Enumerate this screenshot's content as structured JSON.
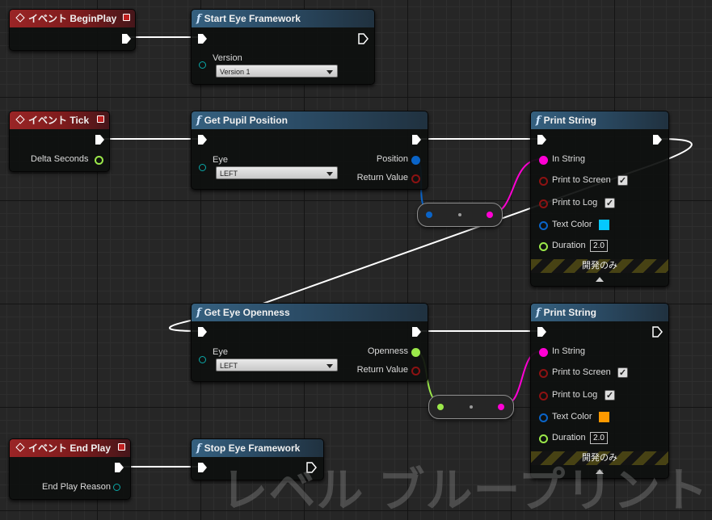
{
  "colors": {
    "exec": "#ffffff",
    "vector": "#0a64c8",
    "bool": "#8c1212",
    "string": "#ff00d4",
    "color_struct": "#0a64c8",
    "float": "#9be84a",
    "text_color_1": "#05c8ff",
    "text_color_2": "#ff9a00"
  },
  "watermark": "レベル ブループリント",
  "nodes": {
    "begin_play": {
      "title": "イベント BeginPlay"
    },
    "start_eye": {
      "title": "Start Eye Framework",
      "version_label": "Version",
      "version_value": "Version 1"
    },
    "tick": {
      "title": "イベント Tick",
      "delta_label": "Delta Seconds"
    },
    "get_pupil": {
      "title": "Get Pupil Position",
      "eye_label": "Eye",
      "eye_value": "LEFT",
      "out_position": "Position",
      "out_return": "Return Value"
    },
    "print1": {
      "title": "Print String",
      "in_string": "In String",
      "print_screen": "Print to Screen",
      "print_log": "Print to Log",
      "text_color": "Text Color",
      "duration": "Duration",
      "duration_value": "2.0",
      "dev_only": "開発のみ"
    },
    "get_openness": {
      "title": "Get Eye Openness",
      "eye_label": "Eye",
      "eye_value": "LEFT",
      "out_openness": "Openness",
      "out_return": "Return Value"
    },
    "print2": {
      "title": "Print String",
      "in_string": "In String",
      "print_screen": "Print to Screen",
      "print_log": "Print to Log",
      "text_color": "Text Color",
      "duration": "Duration",
      "duration_value": "2.0",
      "dev_only": "開発のみ"
    },
    "end_play": {
      "title": "イベント End Play",
      "reason_label": "End Play Reason"
    },
    "stop_eye": {
      "title": "Stop Eye Framework"
    }
  },
  "checkmarks": {
    "check": "✓"
  }
}
